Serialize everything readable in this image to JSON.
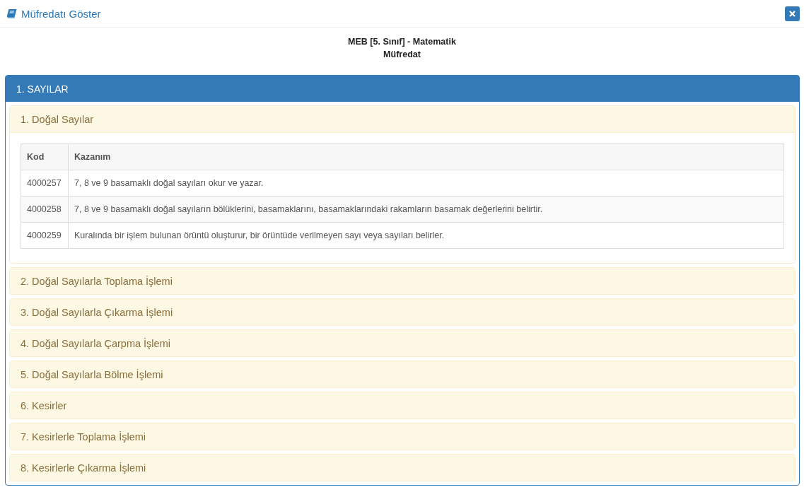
{
  "dialog": {
    "title": "Müfredatı Göster"
  },
  "heading": {
    "line_1": "MEB [5. Sınıf] - Matematik",
    "line_2": "Müfredat"
  },
  "unit": {
    "title": "1. SAYILAR",
    "topics": [
      {
        "title": "1. Doğal Sayılar",
        "expanded": true,
        "table": {
          "columns": [
            "Kod",
            "Kazanım"
          ],
          "rows": [
            {
              "code": "4000257",
              "outcome": "7, 8 ve 9 basamaklı doğal sayıları okur ve yazar."
            },
            {
              "code": "4000258",
              "outcome": "7, 8 ve 9 basamaklı doğal sayıların bölüklerini, basamaklarını, basamaklarındaki rakamların basamak değerlerini belirtir."
            },
            {
              "code": "4000259",
              "outcome": "Kuralında bir işlem bulunan örüntü oluşturur, bir örüntüde verilmeyen sayı veya sayıları belirler."
            }
          ]
        }
      },
      {
        "title": "2. Doğal Sayılarla Toplama İşlemi",
        "expanded": false
      },
      {
        "title": "3. Doğal Sayılarla Çıkarma İşlemi",
        "expanded": false
      },
      {
        "title": "4. Doğal Sayılarla Çarpma İşlemi",
        "expanded": false
      },
      {
        "title": "5. Doğal Sayılarla Bölme İşlemi",
        "expanded": false
      },
      {
        "title": "6. Kesirler",
        "expanded": false
      },
      {
        "title": "7. Kesirlerle Toplama İşlemi",
        "expanded": false
      },
      {
        "title": "8. Kesirlerle Çıkarma İşlemi",
        "expanded": false
      }
    ]
  }
}
